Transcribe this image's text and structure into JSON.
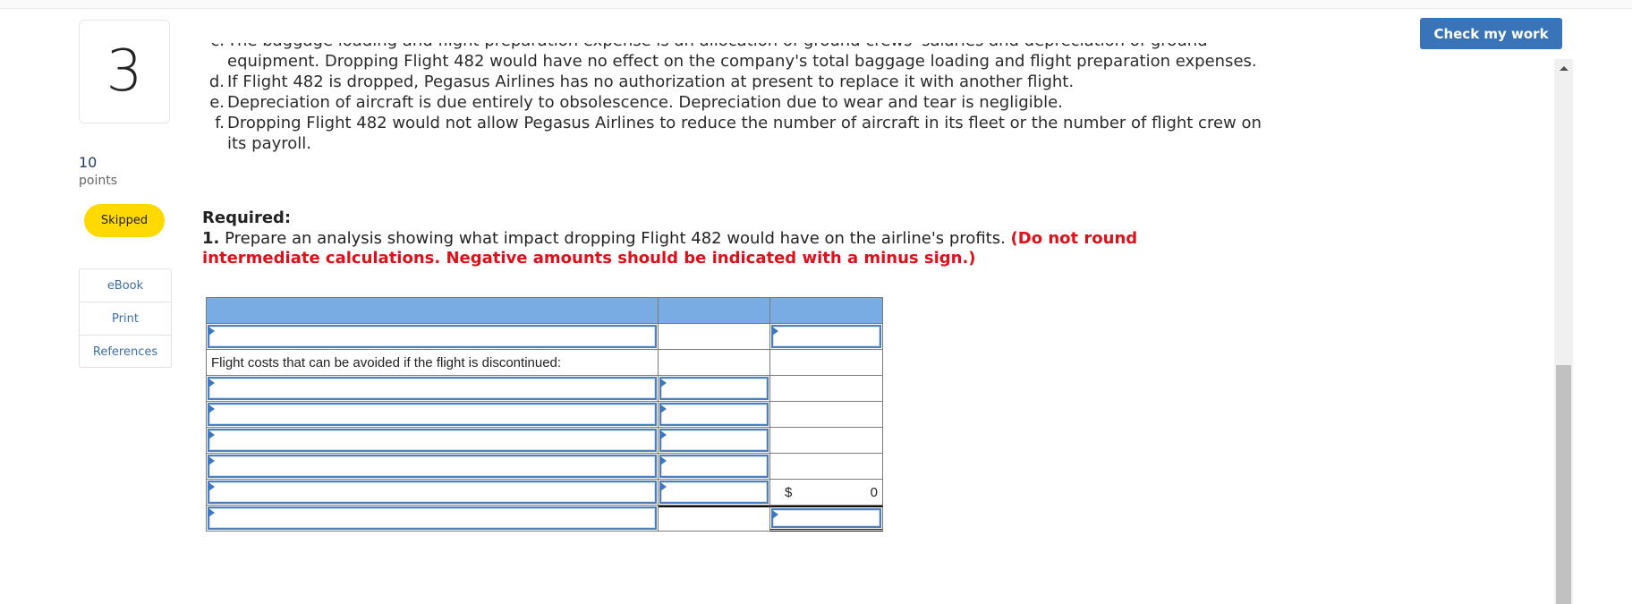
{
  "question": {
    "number": "3",
    "points_value": "10",
    "points_label": "points",
    "status": "Skipped",
    "status_color": "#ffd900"
  },
  "sidebar_links": [
    {
      "label": "eBook"
    },
    {
      "label": "Print"
    },
    {
      "label": "References"
    }
  ],
  "toolbar": {
    "check_label": "Check my work",
    "check_color": "#3a74b8"
  },
  "problem_items": [
    {
      "marker": "c.",
      "text": "The baggage loading and flight preparation expense is an allocation of ground crews' salaries and depreciation of ground equipment. Dropping Flight 482 would have no effect on the company's total baggage loading and flight preparation expenses."
    },
    {
      "marker": "d.",
      "text": "If Flight 482 is dropped, Pegasus Airlines has no authorization at present to replace it with another flight."
    },
    {
      "marker": "e.",
      "text": "Depreciation of aircraft is due entirely to obsolescence. Depreciation due to wear and tear is negligible."
    },
    {
      "marker": "f.",
      "text": "Dropping Flight 482 would not allow Pegasus Airlines to reduce the number of aircraft in its fleet or the number of flight crew on its payroll."
    }
  ],
  "required": {
    "heading": "Required:",
    "number": "1.",
    "text": "Prepare an analysis showing what impact dropping Flight 482 would have on the airline's profits.",
    "instruction": "(Do not round intermediate calculations. Negative amounts should be indicated with a minus sign.)",
    "instruction_color": "#e0101a"
  },
  "table": {
    "header_color": "#78ace3",
    "rows": [
      {
        "c1": {
          "type": "input",
          "value": ""
        },
        "c2": {
          "type": "static",
          "value": ""
        },
        "c3": {
          "type": "input",
          "value": ""
        }
      },
      {
        "c1": {
          "type": "label",
          "value": "Flight costs that can be avoided if the flight is discontinued:"
        },
        "c2": {
          "type": "static",
          "value": ""
        },
        "c3": {
          "type": "static",
          "value": ""
        }
      },
      {
        "c1": {
          "type": "input",
          "value": ""
        },
        "c2": {
          "type": "input",
          "value": ""
        },
        "c3": {
          "type": "static",
          "value": ""
        }
      },
      {
        "c1": {
          "type": "input",
          "value": ""
        },
        "c2": {
          "type": "input",
          "value": ""
        },
        "c3": {
          "type": "static",
          "value": ""
        }
      },
      {
        "c1": {
          "type": "input",
          "value": ""
        },
        "c2": {
          "type": "input",
          "value": ""
        },
        "c3": {
          "type": "static",
          "value": ""
        }
      },
      {
        "c1": {
          "type": "input",
          "value": ""
        },
        "c2": {
          "type": "input",
          "value": ""
        },
        "c3": {
          "type": "static",
          "value": ""
        }
      },
      {
        "c1": {
          "type": "input",
          "value": ""
        },
        "c2": {
          "type": "input",
          "value": ""
        },
        "c3": {
          "type": "total",
          "currency": "$",
          "value": "0"
        }
      },
      {
        "c1": {
          "type": "input",
          "value": ""
        },
        "c2": {
          "type": "static",
          "value": ""
        },
        "c3": {
          "type": "input",
          "value": ""
        }
      }
    ]
  },
  "scrollbar": {
    "position_fraction": 0.56
  }
}
